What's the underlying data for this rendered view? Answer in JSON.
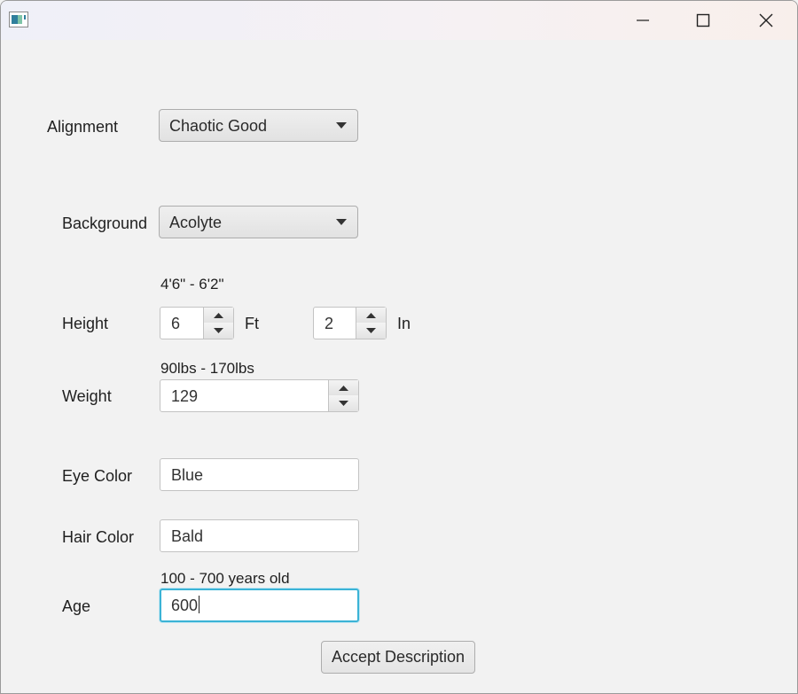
{
  "window": {
    "controls": {
      "minimize": "minimize-icon",
      "maximize": "maximize-icon",
      "close": "close-icon"
    }
  },
  "form": {
    "alignment": {
      "label": "Alignment",
      "value": "Chaotic Good"
    },
    "background": {
      "label": "Background",
      "value": "Acolyte"
    },
    "height": {
      "label": "Height",
      "hint": "4'6\" - 6'2\"",
      "feet": "6",
      "feet_unit": "Ft",
      "inches": "2",
      "inches_unit": "In"
    },
    "weight": {
      "label": "Weight",
      "hint": "90lbs - 170lbs",
      "value": "129"
    },
    "eye_color": {
      "label": "Eye Color",
      "value": "Blue"
    },
    "hair_color": {
      "label": "Hair Color",
      "value": "Bald"
    },
    "age": {
      "label": "Age",
      "hint": "100 - 700 years old",
      "value": "600"
    },
    "accept_label": "Accept Description"
  },
  "colors": {
    "focus": "#3bb3d6",
    "background": "#f2f2f2"
  }
}
